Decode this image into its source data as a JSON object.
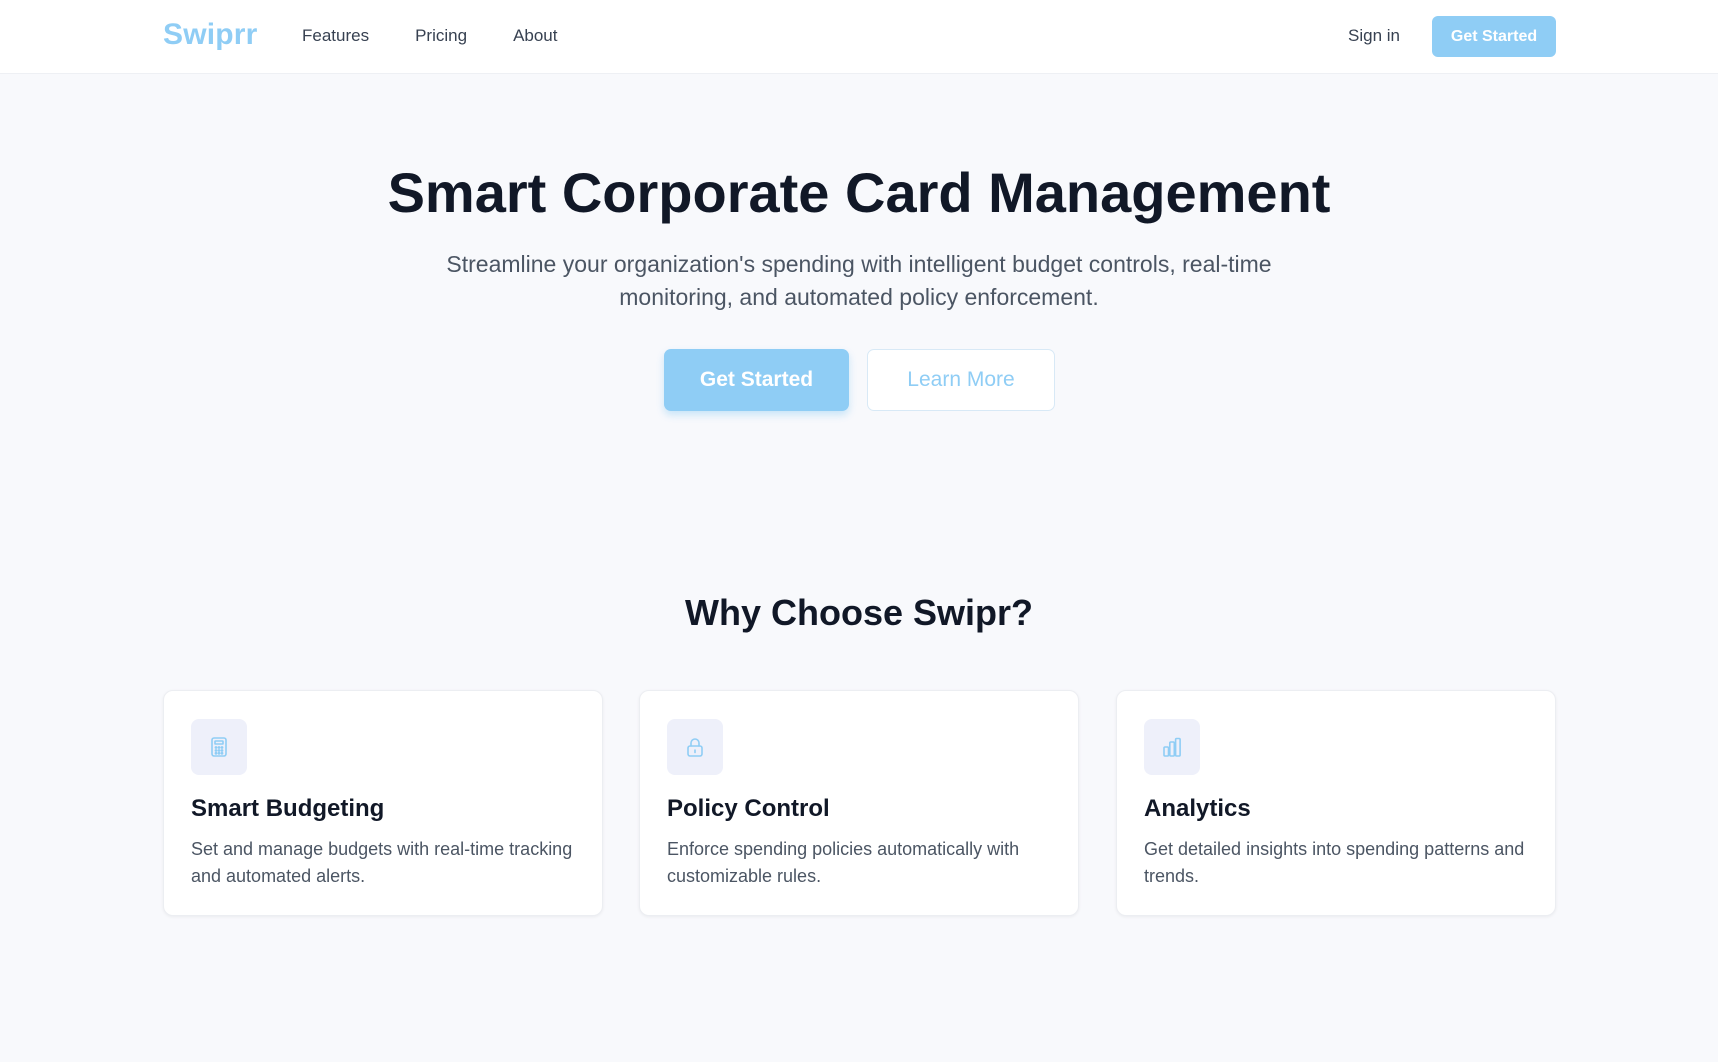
{
  "nav": {
    "logo": "Swiprr",
    "links": [
      "Features",
      "Pricing",
      "About"
    ],
    "signin_label": "Sign in",
    "cta_label": "Get Started"
  },
  "hero": {
    "title": "Smart Corporate Card Management",
    "subtitle": "Streamline your organization's spending with intelligent budget controls, real-time monitoring, and automated policy enforcement.",
    "primary_label": "Get Started",
    "secondary_label": "Learn More"
  },
  "features": {
    "title": "Why Choose Swipr?",
    "cards": [
      {
        "icon": "calculator-icon",
        "title": "Smart Budgeting",
        "description": "Set and manage budgets with real-time tracking and automated alerts."
      },
      {
        "icon": "lock-icon",
        "title": "Policy Control",
        "description": "Enforce spending policies automatically with customizable rules."
      },
      {
        "icon": "bar-chart-icon",
        "title": "Analytics",
        "description": "Get detailed insights into spending patterns and trends."
      }
    ]
  },
  "colors": {
    "accent": "#8fcdf5",
    "text": "#111827",
    "muted": "#4b5563",
    "background": "#f8f9fc"
  }
}
